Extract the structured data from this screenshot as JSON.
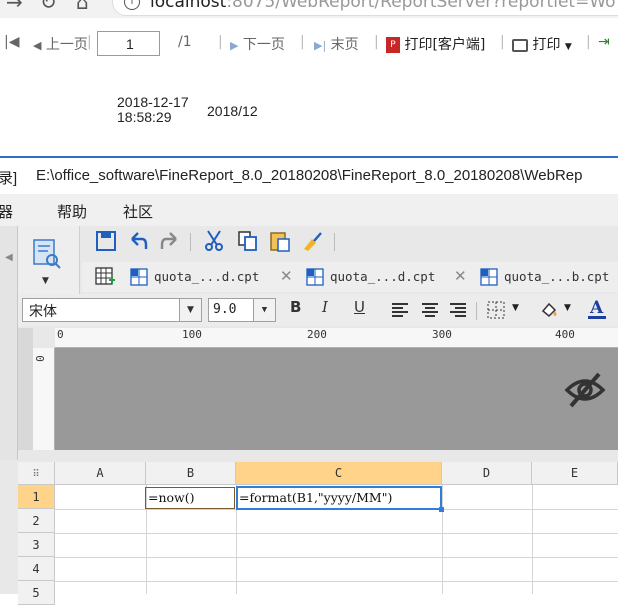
{
  "browser": {
    "url_host": "localhost",
    "url_rest": ":8075/WebReport/ReportServer?reportlet=Wo"
  },
  "report_toolbar": {
    "prev_label": "上一页",
    "page_value": "1",
    "page_total": "/1",
    "next_label": "下一页",
    "last_label": "末页",
    "print_client_label": "打印[客户端]",
    "print_label": "打印"
  },
  "report_content": {
    "now_value_date": "2018-12-17",
    "now_value_time": "18:58:29",
    "formatted_value": "2018/12"
  },
  "designer": {
    "title_prefix": "录]",
    "title_path": "E:\\office_software\\FineReport_8.0_20180208\\FineReport_8.0_20180208\\WebRep",
    "menu": [
      "器",
      "帮助",
      "社区"
    ],
    "tabs": [
      {
        "label": "quota_...d.cpt"
      },
      {
        "label": "quota_...d.cpt"
      },
      {
        "label": "quota_...b.cpt"
      }
    ],
    "font_name": "宋体",
    "font_size": "9.0",
    "format_buttons": [
      "B",
      "I",
      "U"
    ],
    "ruler_labels": [
      "0",
      "100",
      "200",
      "300",
      "400"
    ],
    "vruler_label": "0",
    "columns": [
      "A",
      "B",
      "C",
      "D",
      "E"
    ],
    "rows": [
      "1",
      "2",
      "3",
      "4",
      "5"
    ],
    "cells": {
      "B1": "=now()",
      "C1": "=format(B1,\"yyyy/MM\")"
    },
    "colors": {
      "selection_header": "#ffd48a",
      "selection_border": "#2f7fd8",
      "accent_blue": "#2f6fbf"
    }
  }
}
